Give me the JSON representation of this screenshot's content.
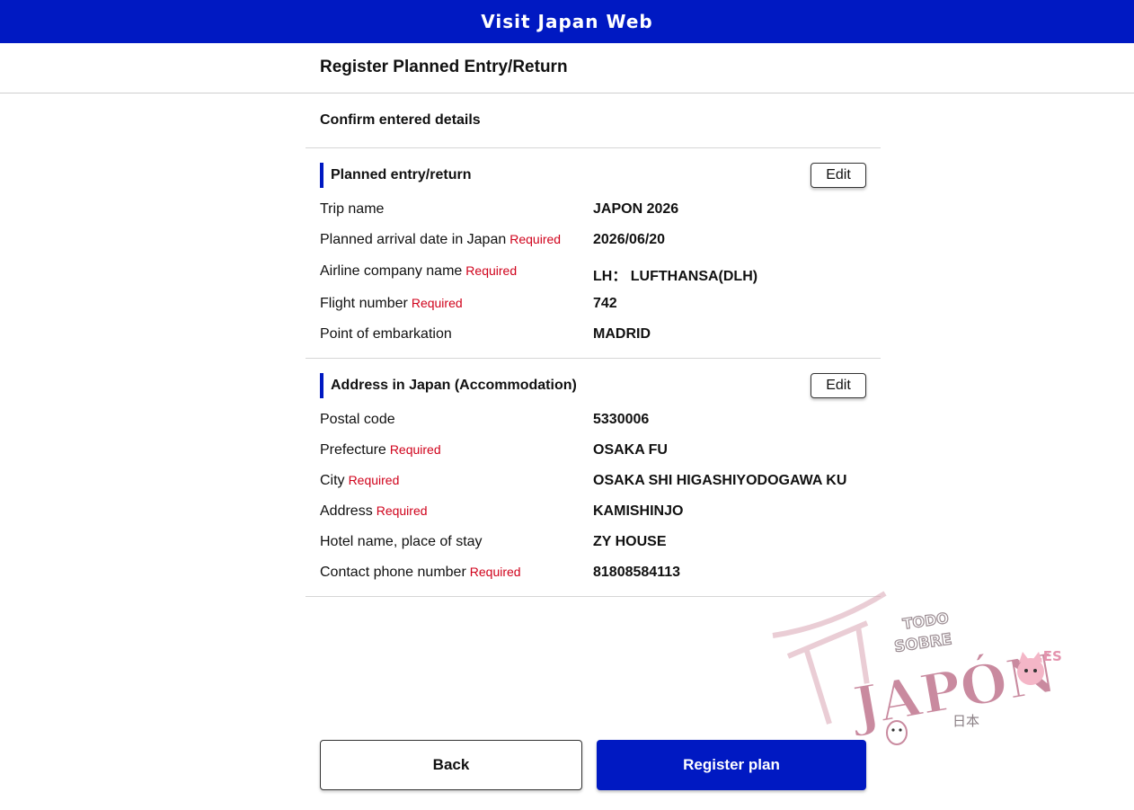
{
  "header": {
    "site_title": "Visit Japan Web"
  },
  "page": {
    "title": "Register Planned Entry/Return",
    "subheading": "Confirm entered details"
  },
  "required_label": "Required",
  "sections": [
    {
      "title": "Planned entry/return",
      "edit_label": "Edit",
      "rows": [
        {
          "label": "Trip name",
          "required": false,
          "value": "JAPON 2026"
        },
        {
          "label": "Planned arrival date in Japan",
          "required": true,
          "value": "2026/06/20"
        },
        {
          "label": "Airline company name",
          "required": true,
          "value": "LH： LUFTHANSA(DLH)"
        },
        {
          "label": "Flight number",
          "required": true,
          "value": "742"
        },
        {
          "label": "Point of embarkation",
          "required": false,
          "value": "MADRID"
        }
      ]
    },
    {
      "title": "Address in Japan (Accommodation)",
      "edit_label": "Edit",
      "rows": [
        {
          "label": "Postal code",
          "required": false,
          "value": "5330006"
        },
        {
          "label": "Prefecture",
          "required": true,
          "value": "OSAKA FU"
        },
        {
          "label": "City",
          "required": true,
          "value": "OSAKA SHI HIGASHIYODOGAWA KU"
        },
        {
          "label": "Address",
          "required": true,
          "value": "KAMISHINJO"
        },
        {
          "label": "Hotel name, place of stay",
          "required": false,
          "value": "ZY HOUSE"
        },
        {
          "label": "Contact phone number",
          "required": true,
          "value": "81808584113"
        }
      ]
    }
  ],
  "actions": {
    "back_label": "Back",
    "register_label": "Register plan"
  },
  "watermark": {
    "line1": "TODO",
    "line2": "SOBRE",
    "brand": "JAPÓN",
    "kanji": "日本",
    "suffix": ".ES"
  },
  "colors": {
    "brand_blue": "#0019c2",
    "required_red": "#d0021b",
    "watermark_pink": "#c98a9f"
  }
}
